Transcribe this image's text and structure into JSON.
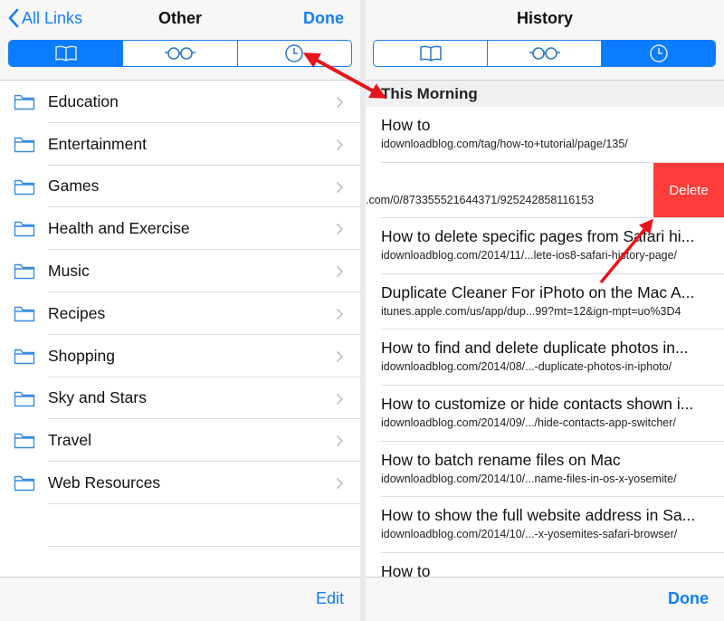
{
  "colors": {
    "accent": "#147efb",
    "segment_active": "#0a7cff",
    "delete": "#fc3d39",
    "annotation_arrow": "#e8141b"
  },
  "left": {
    "nav": {
      "back_label": "All Links",
      "back_icon": "chevron-left-icon",
      "title": "Other",
      "done_label": "Done"
    },
    "segments": [
      {
        "icon": "bookmarks-book-icon",
        "active": true
      },
      {
        "icon": "reading-list-glasses-icon",
        "active": false
      },
      {
        "icon": "history-clock-icon",
        "active": false
      }
    ],
    "folders": [
      {
        "label": "Education"
      },
      {
        "label": "Entertainment"
      },
      {
        "label": "Games"
      },
      {
        "label": "Health and Exercise"
      },
      {
        "label": "Music"
      },
      {
        "label": "Recipes"
      },
      {
        "label": "Shopping"
      },
      {
        "label": "Sky and Stars"
      },
      {
        "label": "Travel"
      },
      {
        "label": "Web Resources"
      }
    ],
    "toolbar": {
      "edit_label": "Edit"
    }
  },
  "right": {
    "nav": {
      "title": "History"
    },
    "segments": [
      {
        "icon": "bookmarks-book-icon",
        "active": false
      },
      {
        "icon": "reading-list-glasses-icon",
        "active": false
      },
      {
        "icon": "history-clock-icon",
        "active": true
      }
    ],
    "section_header": "This Morning",
    "items": [
      {
        "title": "How to",
        "url": "idownloadblog.com/tag/how-to+tutorial/page/135/"
      },
      {
        "title": "",
        "url": ".com/0/873355521644371/925242858116153",
        "swiped": true,
        "delete_label": "Delete"
      },
      {
        "title": "How to delete specific pages from Safari hi...",
        "url": "idownloadblog.com/2014/11/...lete-ios8-safari-history-page/"
      },
      {
        "title": "Duplicate Cleaner For iPhoto on the Mac A...",
        "url": "itunes.apple.com/us/app/dup...99?mt=12&ign-mpt=uo%3D4"
      },
      {
        "title": "How to find and delete duplicate photos in...",
        "url": "idownloadblog.com/2014/08/...-duplicate-photos-in-iphoto/"
      },
      {
        "title": "How to customize or hide contacts shown i...",
        "url": "idownloadblog.com/2014/09/.../hide-contacts-app-switcher/"
      },
      {
        "title": "How to batch rename files on Mac",
        "url": "idownloadblog.com/2014/10/...name-files-in-os-x-yosemite/"
      },
      {
        "title": "How to show the full website address in Sa...",
        "url": "idownloadblog.com/2014/10/...-x-yosemites-safari-browser/"
      },
      {
        "title": "How to",
        "url": ""
      }
    ],
    "toolbar": {
      "done_label": "Done"
    }
  }
}
